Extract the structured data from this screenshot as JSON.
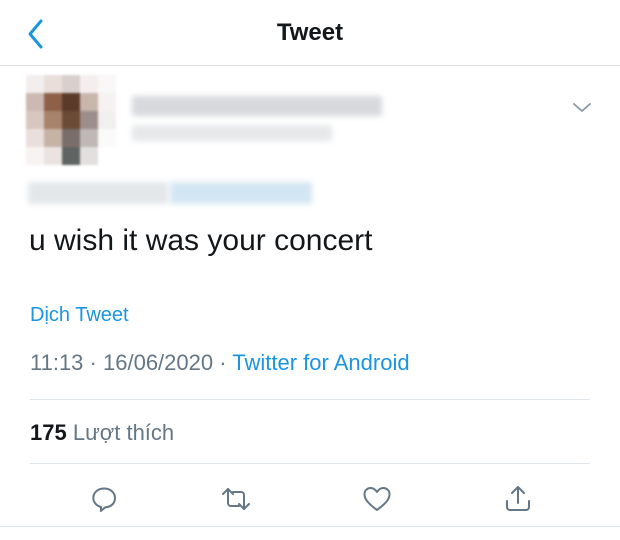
{
  "header": {
    "title": "Tweet"
  },
  "tweet": {
    "text": "u wish it was your concert",
    "translate_label": "Dịch Tweet",
    "time": "11:13",
    "date": "16/06/2020",
    "source": "Twitter for Android",
    "separator": "·",
    "likes_count": "175",
    "likes_label": "Lượt thích"
  },
  "icons": {
    "back": "chevron-left-icon",
    "more": "chevron-down-icon",
    "reply": "reply-icon",
    "retweet": "retweet-icon",
    "like": "heart-icon",
    "share": "share-icon"
  },
  "colors": {
    "accent": "#1b95e0",
    "secondary_text": "#657786",
    "primary_text": "#14171a",
    "divider": "#e1e6ea"
  }
}
